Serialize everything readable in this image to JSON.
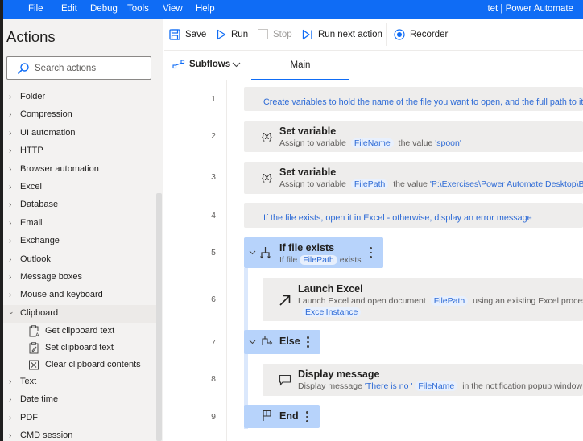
{
  "window": {
    "title": "tet | Power Automate",
    "menu": [
      "File",
      "Edit",
      "Debug",
      "Tools",
      "View",
      "Help"
    ]
  },
  "sidebar": {
    "heading": "Actions",
    "search": {
      "placeholder": "Search actions",
      "value": ""
    },
    "groups_top": [
      {
        "label": "Folder",
        "icon": "chevron-right-icon"
      },
      {
        "label": "Compression",
        "icon": "chevron-right-icon"
      },
      {
        "label": "UI automation",
        "icon": "chevron-right-icon"
      },
      {
        "label": "HTTP",
        "icon": "chevron-right-icon"
      },
      {
        "label": "Browser automation",
        "icon": "chevron-right-icon"
      },
      {
        "label": "Excel",
        "icon": "chevron-right-icon"
      },
      {
        "label": "Database",
        "icon": "chevron-right-icon"
      },
      {
        "label": "Email",
        "icon": "chevron-right-icon"
      },
      {
        "label": "Exchange",
        "icon": "chevron-right-icon"
      },
      {
        "label": "Outlook",
        "icon": "chevron-right-icon"
      },
      {
        "label": "Message boxes",
        "icon": "chevron-right-icon"
      },
      {
        "label": "Mouse and keyboard",
        "icon": "chevron-right-icon"
      }
    ],
    "expanded_group": {
      "label": "Clipboard",
      "icon": "chevron-down-icon",
      "children": [
        {
          "label": "Get clipboard text",
          "icon": "clipboard-get-icon"
        },
        {
          "label": "Set clipboard text",
          "icon": "clipboard-set-icon"
        },
        {
          "label": "Clear clipboard contents",
          "icon": "clipboard-clear-icon"
        }
      ]
    },
    "groups_bottom": [
      {
        "label": "Text",
        "icon": "chevron-right-icon"
      },
      {
        "label": "Date time",
        "icon": "chevron-right-icon"
      },
      {
        "label": "PDF",
        "icon": "chevron-right-icon"
      },
      {
        "label": "CMD session",
        "icon": "chevron-right-icon"
      }
    ]
  },
  "toolbar": {
    "save": "Save",
    "run": "Run",
    "stop": "Stop",
    "run_next": "Run next action",
    "recorder": "Recorder"
  },
  "tabs": {
    "subflows": "Subflows",
    "main": "Main"
  },
  "flow": {
    "line_numbers": [
      "1",
      "2",
      "3",
      "4",
      "5",
      "6",
      "7",
      "8",
      "9"
    ],
    "step1": {
      "comment": "Create variables to hold the name of the file you want to open, and the full path to it"
    },
    "step2": {
      "icon": "{x}",
      "title": "Set variable",
      "desc_prefix": "Assign to variable",
      "variable": "FileName",
      "desc_mid": "the value",
      "value": "'spoon'"
    },
    "step3": {
      "icon": "{x}",
      "title": "Set variable",
      "desc_prefix": "Assign to variable",
      "variable": "FilePath",
      "desc_mid": "the value",
      "value": "'P:\\Exercises\\Power Automate Desktop\\Bas"
    },
    "step4": {
      "comment": "If the file exists, open it in Excel - otherwise, display an error message"
    },
    "step5": {
      "title": "If file exists",
      "desc_prefix": "If file",
      "variable": "FilePath",
      "desc_suffix": "exists"
    },
    "step6": {
      "title": "Launch Excel",
      "desc_prefix": "Launch Excel and open document",
      "variable": "FilePath",
      "desc_suffix": "using an existing Excel process",
      "variable2": "ExcelInstance"
    },
    "step7": {
      "title": "Else"
    },
    "step8": {
      "title": "Display message",
      "desc_prefix": "Display message",
      "value": "'There is no '",
      "variable": "FileName",
      "desc_suffix": "in the notification popup window"
    },
    "step9": {
      "title": "End"
    }
  },
  "colors": {
    "accent": "#0f6cf5",
    "block_bg": "#b7d3fb",
    "card_bg": "#eeedec",
    "link_blue": "#2e6bd6"
  }
}
